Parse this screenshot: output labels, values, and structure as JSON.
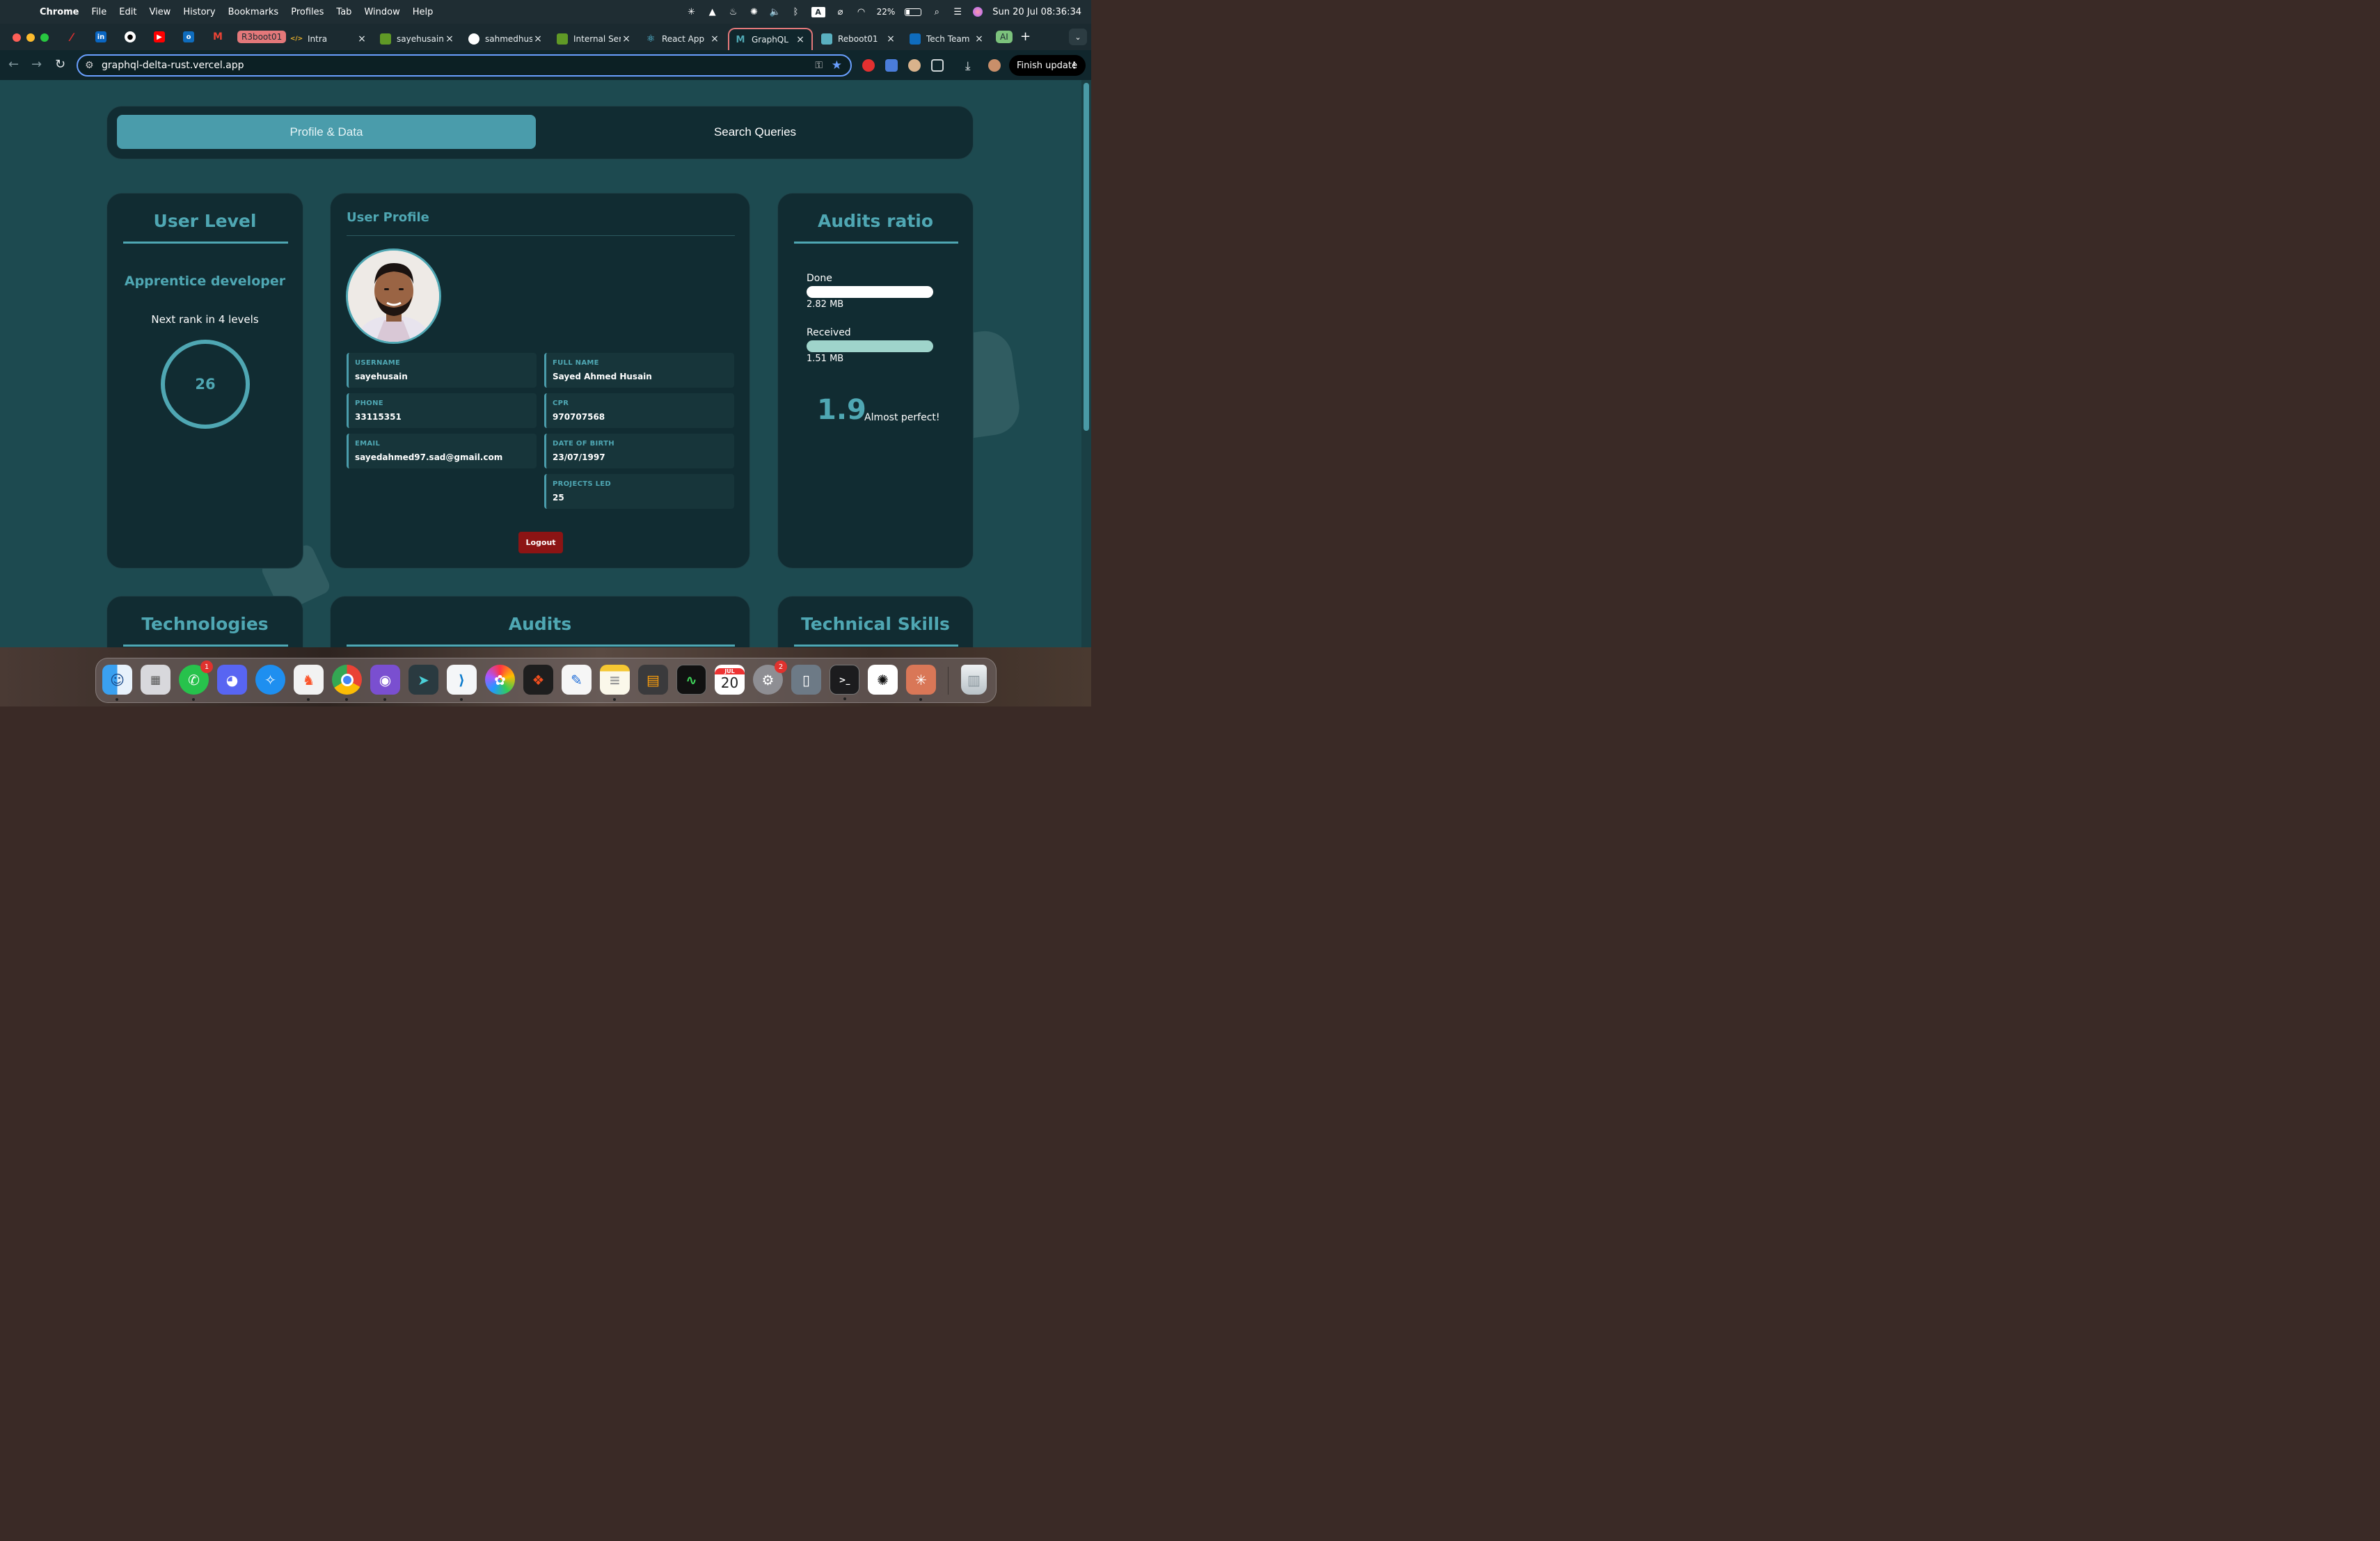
{
  "menubar": {
    "app": "Chrome",
    "items": [
      "File",
      "Edit",
      "View",
      "History",
      "Bookmarks",
      "Profiles",
      "Tab",
      "Window",
      "Help"
    ],
    "battery": "22%",
    "clock": "Sun 20 Jul  08:36:34",
    "input_source": "A"
  },
  "tabs": {
    "group_chip": "R3boot01",
    "ai_chip": "AI",
    "items": [
      {
        "title": "Intra",
        "icon": "code-icon"
      },
      {
        "title": "sayehusain/",
        "icon": "gitea-icon"
      },
      {
        "title": "sahmedhus",
        "icon": "github-icon"
      },
      {
        "title": "Internal Ser",
        "icon": "gitea-icon"
      },
      {
        "title": "React App",
        "icon": "react-icon"
      },
      {
        "title": "GraphQL",
        "icon": "graphql-app-icon",
        "active": true
      },
      {
        "title": "Reboot01",
        "icon": "reboot-icon"
      },
      {
        "title": "Tech Team",
        "icon": "outlook-icon"
      }
    ]
  },
  "toolbar": {
    "url": "graphql-delta-rust.vercel.app",
    "finish_update": "Finish update"
  },
  "page": {
    "nav": {
      "profile_tab": "Profile & Data",
      "search_tab": "Search Queries"
    },
    "user_level": {
      "title": "User Level",
      "rank": "Apprentice developer",
      "next_rank": "Next rank in 4 levels",
      "level": "26"
    },
    "profile": {
      "title": "User Profile",
      "fields": [
        {
          "label": "USERNAME",
          "value": "sayehusain"
        },
        {
          "label": "FULL NAME",
          "value": "Sayed Ahmed Husain"
        },
        {
          "label": "PHONE",
          "value": "33115351"
        },
        {
          "label": "CPR",
          "value": "970707568"
        },
        {
          "label": "EMAIL",
          "value": "sayedahmed97.sad@gmail.com"
        },
        {
          "label": "DATE OF BIRTH",
          "value": "23/07/1997"
        },
        {
          "label": "PROJECTS LED",
          "value": "25"
        }
      ],
      "logout": "Logout"
    },
    "audits_ratio": {
      "title": "Audits ratio",
      "done_label": "Done",
      "done_value": "2.82 MB",
      "done_fill": 1.0,
      "received_label": "Received",
      "received_value": "1.51 MB",
      "received_fill": 1.0,
      "ratio": "1.9",
      "message": "Almost perfect!",
      "colors": {
        "done": "#ffffff",
        "received": "#9fd4cb"
      }
    },
    "bottom_cards": {
      "technologies": "Technologies",
      "audits": "Audits",
      "skills": "Technical Skills"
    }
  },
  "dock": {
    "apps": [
      "Finder",
      "Launchpad",
      "WhatsApp",
      "Discord",
      "Safari",
      "Brave",
      "Chrome",
      "GitHub Desktop",
      "Prompt",
      "VS Code",
      "Photos",
      "Figma",
      "Freeform",
      "Notes",
      "Calculator",
      "Activity Monitor",
      "Calendar",
      "System Settings",
      "iPhone Mirroring",
      "Terminal",
      "ChatGPT",
      "Claude",
      "Trash"
    ],
    "whatsapp_badge": "1",
    "settings_badge": "2",
    "calendar_month": "JUL",
    "calendar_day": "20"
  },
  "theme": {
    "accent": "#4fa7b3",
    "card_bg": "#112c32",
    "page_bg": "#1d4a50",
    "logout_red": "#8c1414"
  }
}
